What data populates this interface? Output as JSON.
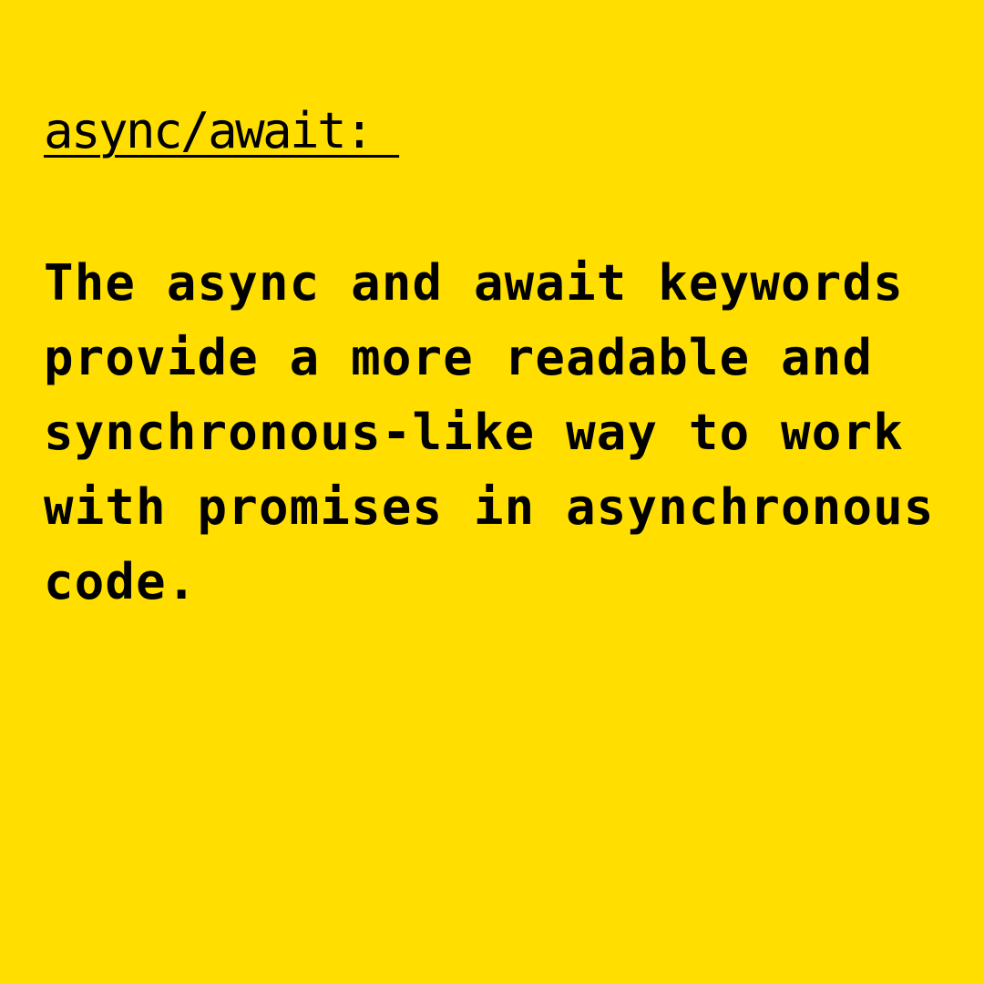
{
  "colors": {
    "background": "#FFDE00",
    "text": "#000000"
  },
  "heading": "async/await: ",
  "body_lines": [
    "The async and await keywords",
    "provide a more readable and",
    "synchronous-like way to work",
    "with promises in asynchronous",
    "code."
  ]
}
